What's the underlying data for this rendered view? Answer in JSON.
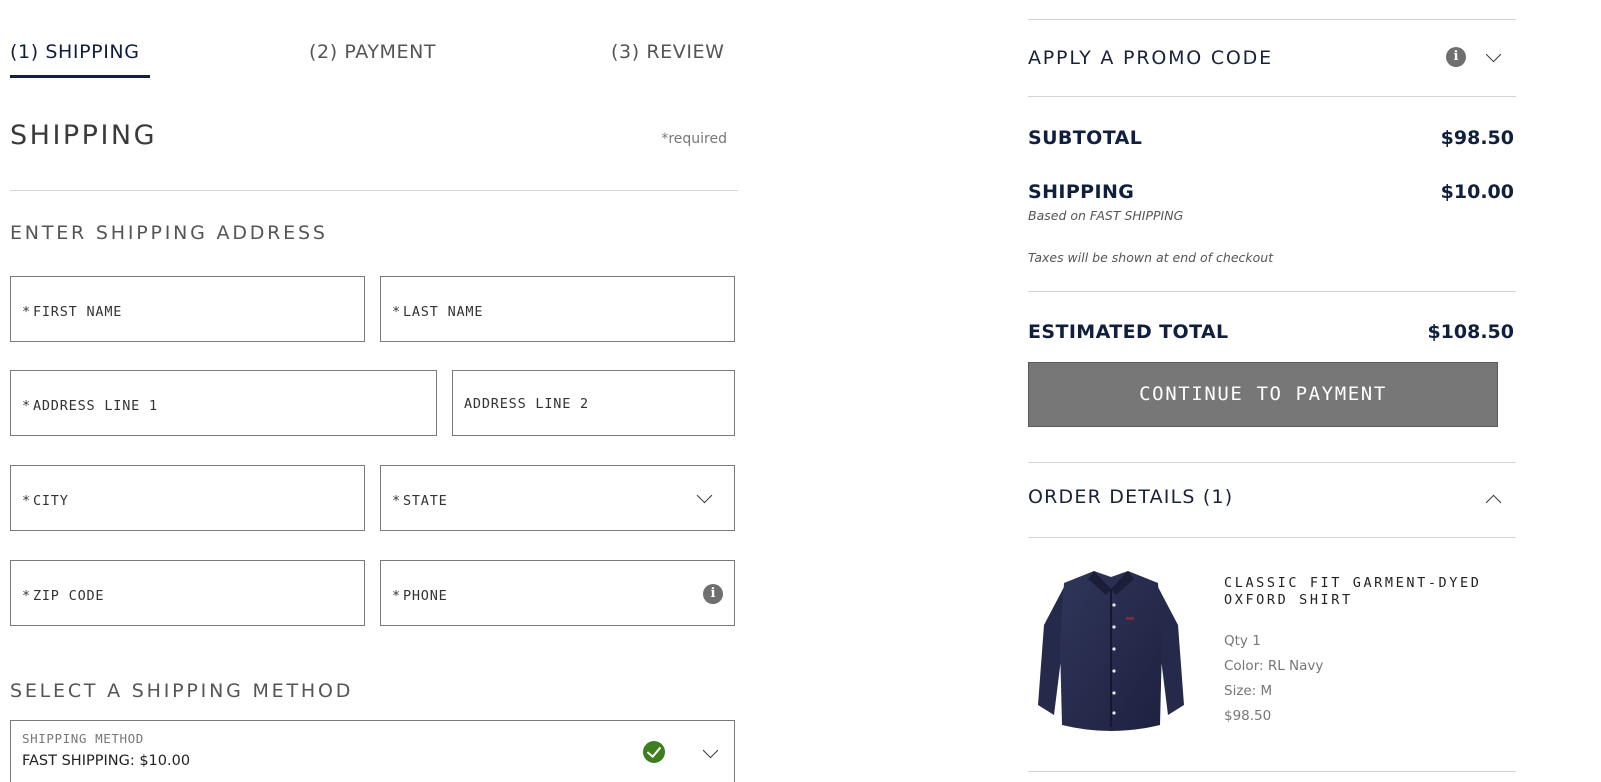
{
  "steps": {
    "shipping": "(1) SHIPPING",
    "payment": "(2) PAYMENT",
    "review": "(3) REVIEW"
  },
  "shipping_section": {
    "title": "SHIPPING",
    "required_note": "*required",
    "address_heading": "ENTER SHIPPING ADDRESS",
    "fields": {
      "first_name": "FIRST NAME",
      "last_name": "LAST NAME",
      "address1": "ADDRESS LINE 1",
      "address2": "ADDRESS LINE 2",
      "city": "CITY",
      "state": "STATE",
      "zip": "ZIP CODE",
      "phone": "PHONE"
    },
    "required_marker": "*",
    "method_heading": "SELECT A SHIPPING METHOD",
    "method_label": "SHIPPING METHOD",
    "method_value": "FAST SHIPPING: $10.00"
  },
  "summary": {
    "promo_label": "APPLY A PROMO CODE",
    "subtotal_label": "SUBTOTAL",
    "subtotal_value": "$98.50",
    "shipping_label": "SHIPPING",
    "shipping_value": "$10.00",
    "shipping_note": "Based on FAST SHIPPING",
    "tax_note": "Taxes will be shown at end of checkout",
    "total_label": "ESTIMATED TOTAL",
    "total_value": "$108.50",
    "cta_label": "CONTINUE TO PAYMENT"
  },
  "order": {
    "title": "ORDER DETAILS (1)",
    "item": {
      "name": "CLASSIC FIT GARMENT-DYED OXFORD SHIRT",
      "qty": "Qty 1",
      "color": "Color: RL Navy",
      "size": "Size: M",
      "price": "$98.50"
    }
  },
  "colors": {
    "navy": "#0f1f3d",
    "button_gray": "#777777",
    "success_green": "#3e7e1e",
    "shirt_navy": "#262a4a"
  },
  "icons": {
    "info": "info-icon",
    "chevron_down": "chevron-down-icon",
    "chevron_up": "chevron-up-icon",
    "check": "check-circle-icon"
  }
}
